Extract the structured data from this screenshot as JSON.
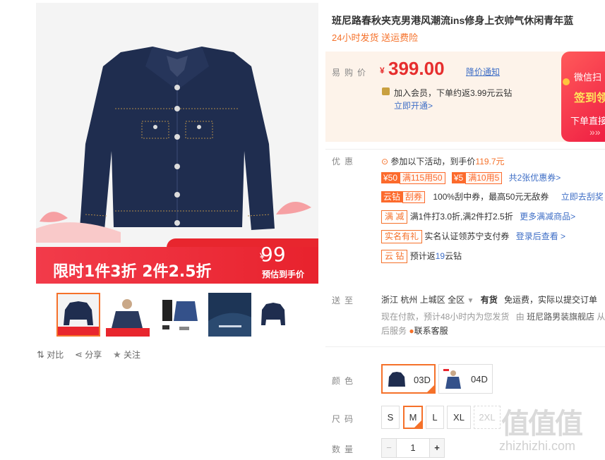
{
  "product": {
    "title": "班尼路春秋夹克男港风潮流ins修身上衣帅气休闲青年蓝",
    "subtitle": "24小时发货 送运费险"
  },
  "main_image": {
    "promo_text": "限时1件3折 2件2.5折",
    "promo_price_symbol": "¥",
    "promo_price": "99",
    "promo_sub": "预估到手价"
  },
  "actions": {
    "compare": "对比",
    "share": "分享",
    "follow": "关注"
  },
  "price": {
    "label": "易购价",
    "symbol": "¥",
    "value": "399.00",
    "notify": "降价通知",
    "member_text": "加入会员，下单约返3.99元云钻",
    "member_link": "立即开通>"
  },
  "banner": {
    "line1": "微信扫",
    "line2": "签到领",
    "line3": "下单直接",
    "arrows": "»»"
  },
  "discount": {
    "label": "优惠",
    "activity": "参加以下活动，到手价",
    "activity_price": "119.7元",
    "coupon1_amount": "¥50",
    "coupon1_cond": "满115用50",
    "coupon2_amount": "¥5",
    "coupon2_cond": "满10用5",
    "coupon_total": "共2张优惠券>",
    "yunzuan_tag": "云钻",
    "guaquan_tag": "刮券",
    "guaquan_text": "100%刮中券，最高50元无敌券",
    "guaquan_link": "立即去刮奖",
    "manjian_tag": "满 减",
    "manjian_text": "满1件打3.0折,满2件打2.5折",
    "manjian_link": "更多满减商品>",
    "shiming_tag": "实名有礼",
    "shiming_text": "实名认证领苏宁支付券",
    "shiming_link": "登录后查看 >",
    "yunzuan2_tag": "云 钻",
    "yunzuan2_text": "预计返",
    "yunzuan2_num": "19",
    "yunzuan2_unit": "云钻"
  },
  "delivery": {
    "label": "送至",
    "province": "浙江",
    "city": "杭州",
    "district": "上城区",
    "area": "全区",
    "stock": "有货",
    "freight": "免运费，实际以提交订单",
    "pay_note": "现在付款，预计48小时内为您发货",
    "shop_prefix": "由",
    "shop_name": "班尼路男装旗舰店",
    "shop_suffix": "从",
    "aftersale": "后服务",
    "service": "联系客服"
  },
  "color": {
    "label": "颜色",
    "options": [
      "03D",
      "04D"
    ]
  },
  "size": {
    "label": "尺码",
    "options": [
      "S",
      "M",
      "L",
      "XL",
      "2XL"
    ]
  },
  "quantity": {
    "label": "数量",
    "value": "1",
    "minus": "−",
    "plus": "+"
  },
  "watermark": {
    "logo": "值值值",
    "site": "zhizhizhi.com"
  },
  "colors": {
    "accent": "#f5712a",
    "price": "#e62e2e",
    "link": "#3e6ec6",
    "jacket": "#1f2d4f"
  }
}
